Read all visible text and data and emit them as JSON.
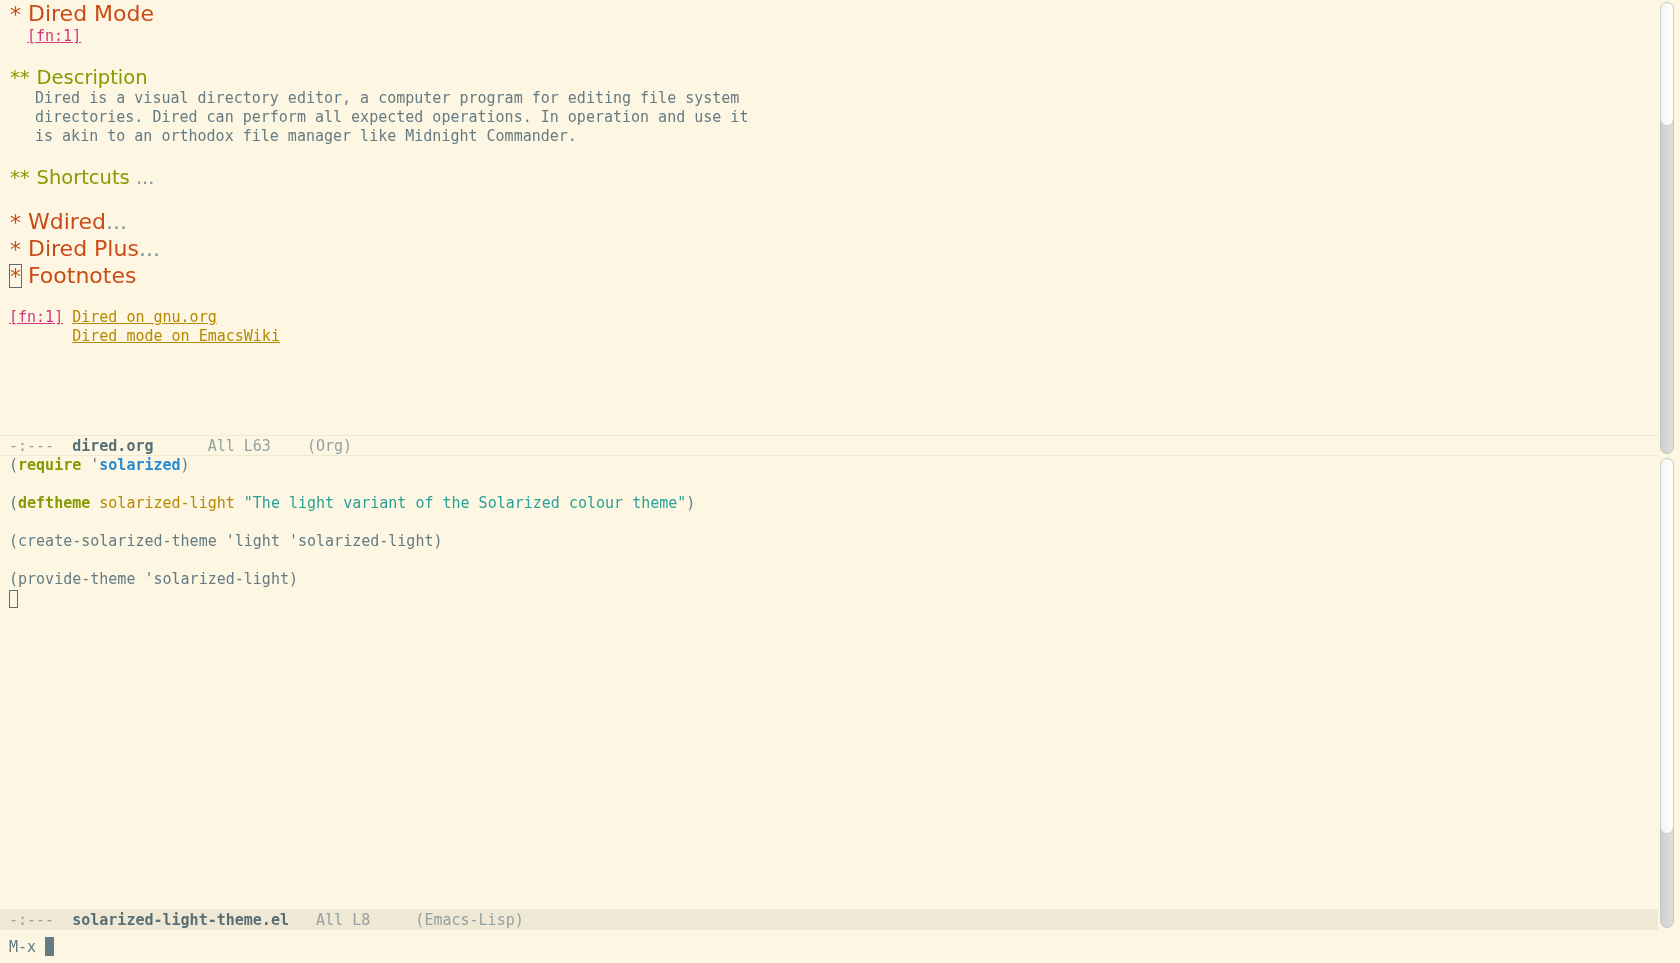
{
  "top_window": {
    "lines": [
      {
        "kind": "h1",
        "stars": "*",
        "title": "Dired Mode",
        "cursor": false
      },
      {
        "kind": "fnref",
        "text": "[fn:1]"
      },
      {
        "kind": "blank"
      },
      {
        "kind": "h2",
        "stars": "**",
        "title": "Description",
        "cursor": false
      },
      {
        "kind": "para",
        "lines": [
          "Dired is a visual directory editor, a computer program for editing file system",
          "directories. Dired can perform all expected operations. In operation and use it",
          "is akin to an orthodox file manager like Midnight Commander."
        ]
      },
      {
        "kind": "blank"
      },
      {
        "kind": "h2",
        "stars": "**",
        "title": "Shortcuts",
        "ellipsis": " ...",
        "cursor": false
      },
      {
        "kind": "blank"
      },
      {
        "kind": "h1",
        "stars": "*",
        "title": "Wdired",
        "ellipsis": "...",
        "cursor": false
      },
      {
        "kind": "h1",
        "stars": "*",
        "title": "Dired Plus",
        "ellipsis": "...",
        "cursor": false
      },
      {
        "kind": "h1",
        "stars": "*",
        "title": "Footnotes",
        "cursor": true
      },
      {
        "kind": "blank"
      },
      {
        "kind": "fndef",
        "label": "[fn:1]",
        "links": [
          "Dired on gnu.org",
          "Dired mode on EmacsWiki"
        ]
      }
    ],
    "mode_line": {
      "flags": "-:---",
      "buffer": "dired.org",
      "position": "All L63",
      "mode": "(Org)",
      "active": false
    }
  },
  "bottom_window": {
    "lines": [
      {
        "kind": "code",
        "tokens": [
          {
            "text": "(",
            "kind": "plain"
          },
          {
            "text": "require",
            "kind": "keyword"
          },
          {
            "text": " '",
            "kind": "plain"
          },
          {
            "text": "solarized",
            "kind": "constant"
          },
          {
            "text": ")",
            "kind": "plain"
          }
        ]
      },
      {
        "kind": "blank"
      },
      {
        "kind": "code",
        "tokens": [
          {
            "text": "(",
            "kind": "plain"
          },
          {
            "text": "deftheme",
            "kind": "keyword"
          },
          {
            "text": " solarized-light ",
            "kind": "name"
          },
          {
            "text": "\"The light variant of the Solarized colour theme\"",
            "kind": "string"
          },
          {
            "text": ")",
            "kind": "plain"
          }
        ]
      },
      {
        "kind": "blank"
      },
      {
        "kind": "code",
        "tokens": [
          {
            "text": "(create-solarized-theme 'light 'solarized-light)",
            "kind": "plain"
          }
        ]
      },
      {
        "kind": "blank"
      },
      {
        "kind": "code",
        "tokens": [
          {
            "text": "(provide-theme 'solarized-light)",
            "kind": "plain"
          }
        ]
      },
      {
        "kind": "cursor"
      }
    ],
    "mode_line": {
      "flags": "-:---",
      "buffer": "solarized-light-theme.el",
      "position": "All L8",
      "mode": "(Emacs-Lisp)",
      "active": true
    }
  },
  "minibuffer": {
    "prompt": "M-x",
    "cursor": true
  }
}
